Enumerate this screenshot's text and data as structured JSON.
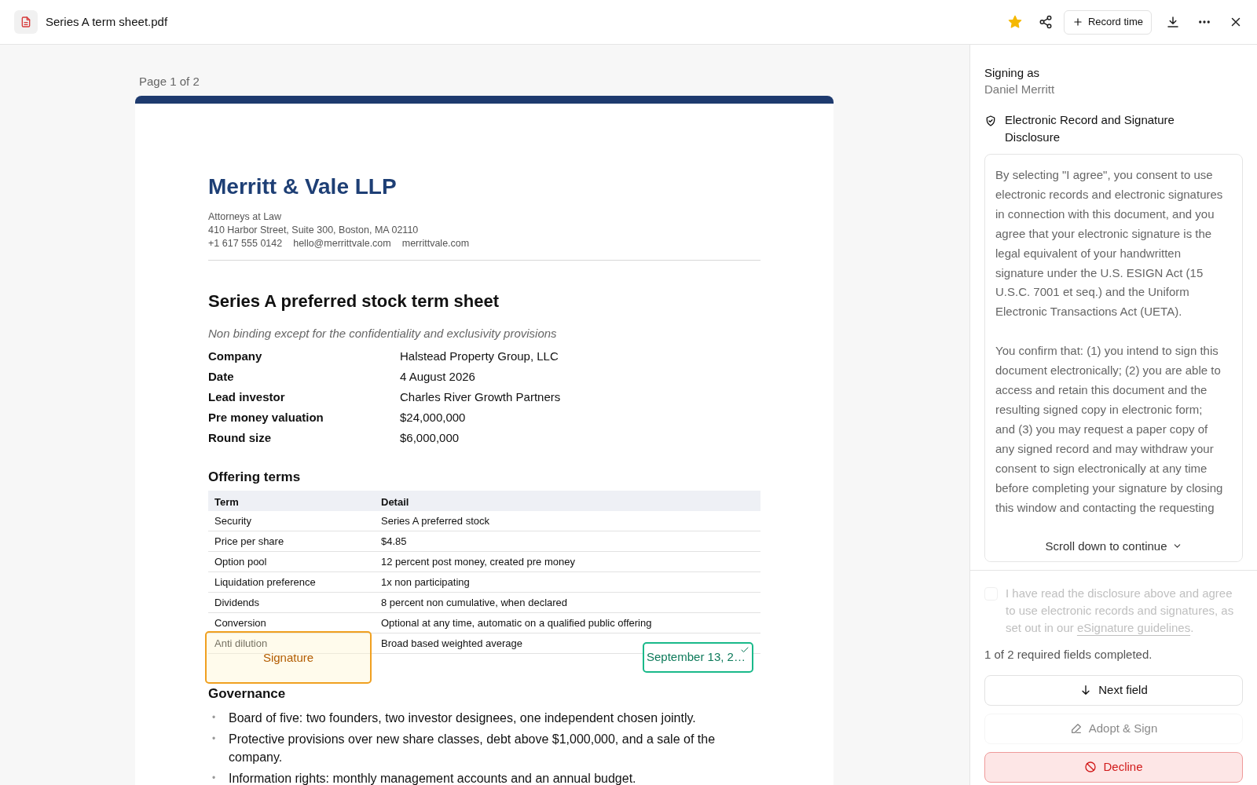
{
  "header": {
    "file_name": "Series A term sheet.pdf",
    "starred": true,
    "record_button": "Record time"
  },
  "document": {
    "page_label": "Page 1 of 2",
    "firm": {
      "name": "Merritt & Vale LLP",
      "tagline": "Attorneys at Law",
      "address": "410 Harbor Street, Suite 300, Boston, MA 02110",
      "contacts": [
        "+1 617 555 0142",
        "hello@merrittvale.com",
        "merrittvale.com"
      ]
    },
    "title": "Series A preferred stock term sheet",
    "subtitle": "Non binding except for the confidentiality and exclusivity provisions",
    "summary": [
      {
        "label": "Company",
        "value": "Halstead Property Group, LLC"
      },
      {
        "label": "Date",
        "value": "4 August 2026"
      },
      {
        "label": "Lead investor",
        "value": "Charles River Growth Partners"
      },
      {
        "label": "Pre money valuation",
        "value": "$24,000,000"
      },
      {
        "label": "Round size",
        "value": "$6,000,000"
      }
    ],
    "offering": {
      "heading": "Offering terms",
      "columns": [
        "Term",
        "Detail"
      ],
      "rows": [
        [
          "Security",
          "Series A preferred stock"
        ],
        [
          "Price per share",
          "$4.85"
        ],
        [
          "Option pool",
          "12 percent post money, created pre money"
        ],
        [
          "Liquidation preference",
          "1x non participating"
        ],
        [
          "Dividends",
          "8 percent non cumulative, when declared"
        ],
        [
          "Conversion",
          "Optional at any time, automatic on a qualified public offering"
        ],
        [
          "Anti dilution",
          "Broad based weighted average"
        ]
      ]
    },
    "governance": {
      "heading": "Governance",
      "bullet_mark": "•",
      "bullets": [
        "Board of five: two founders, two investor designees, one independent chosen jointly.",
        "Protective provisions over new share classes, debt above $1,000,000, and a sale of the company.",
        "Information rights: monthly management accounts and an annual budget."
      ]
    },
    "fields": [
      {
        "kind": "signature",
        "label": "Signature",
        "completed": false
      },
      {
        "kind": "date",
        "value": "September 13, 2…",
        "completed": true
      }
    ]
  },
  "panel": {
    "signing_label": "Signing as",
    "signer": "Daniel Merritt",
    "disclosure_title": "Electronic Record and Signature Disclosure",
    "disclosure_paragraphs": [
      "By selecting \"I agree\", you consent to use electronic records and electronic signatures in connection with this document, and you agree that your electronic signature is the legal equivalent of your handwritten signature under the U.S. ESIGN Act (15 U.S.C. 7001 et seq.) and the Uniform Electronic Transactions Act (UETA).",
      "You confirm that: (1) you intend to sign this document electronically; (2) you are able to access and retain this document and the resulting signed copy in electronic form; and (3) you may request a paper copy of any signed record and may withdraw your consent to sign electronically at any time before completing your signature by closing this window and contacting the requesting"
    ],
    "scroll_hint": "Scroll down to continue",
    "agreement": {
      "text_before": "I have read the disclosure above and agree to use electronic records and signatures, as set out in our ",
      "link": "eSignature guidelines",
      "text_after": ".",
      "checked": false,
      "disabled": true
    },
    "progress": "1 of 2 required fields completed.",
    "buttons": [
      {
        "kind": "next",
        "label": "Next field",
        "disabled": false
      },
      {
        "kind": "adopt",
        "label": "Adopt & Sign",
        "disabled": true
      },
      {
        "kind": "decline",
        "label": "Decline",
        "disabled": false
      }
    ]
  }
}
